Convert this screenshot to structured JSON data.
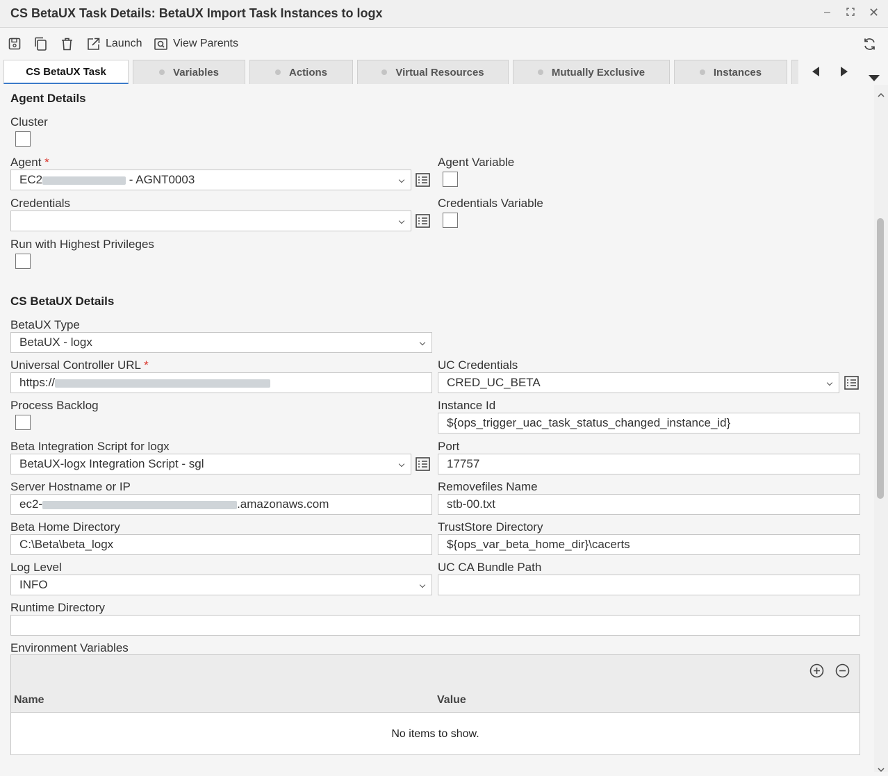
{
  "window": {
    "title": "CS BetaUX Task Details: BetaUX Import Task Instances to logx"
  },
  "toolbar": {
    "launch_label": "Launch",
    "view_parents_label": "View Parents"
  },
  "tabs": [
    {
      "label": "CS BetaUX Task"
    },
    {
      "label": "Variables"
    },
    {
      "label": "Actions"
    },
    {
      "label": "Virtual Resources"
    },
    {
      "label": "Mutually Exclusive"
    },
    {
      "label": "Instances"
    }
  ],
  "agent_details": {
    "title": "Agent Details",
    "cluster_label": "Cluster",
    "agent_label": "Agent",
    "agent_value_prefix": "EC2",
    "agent_value_suffix": " - AGNT0003",
    "agent_variable_label": "Agent Variable",
    "credentials_label": "Credentials",
    "credentials_value": "",
    "credentials_variable_label": "Credentials Variable",
    "highest_privileges_label": "Run with Highest Privileges"
  },
  "betaux_details": {
    "title": "CS BetaUX Details",
    "type_label": "BetaUX Type",
    "type_value": "BetaUX - logx",
    "uc_url_label": "Universal Controller URL",
    "uc_url_prefix": "https://",
    "uc_credentials_label": "UC Credentials",
    "uc_credentials_value": "CRED_UC_BETA",
    "process_backlog_label": "Process Backlog",
    "instance_id_label": "Instance Id",
    "instance_id_value": "${ops_trigger_uac_task_status_changed_instance_id}",
    "script_label": "Beta Integration Script for logx",
    "script_value": "BetaUX-logx Integration Script - sgl",
    "port_label": "Port",
    "port_value": "17757",
    "server_label": "Server Hostname or IP",
    "server_prefix": "ec2-",
    "server_suffix": ".amazonaws.com",
    "removefiles_label": "Removefiles Name",
    "removefiles_value": "stb-00.txt",
    "home_dir_label": "Beta Home Directory",
    "home_dir_value": "C:\\Beta\\beta_logx",
    "truststore_label": "TrustStore Directory",
    "truststore_value": "${ops_var_beta_home_dir}\\cacerts",
    "log_level_label": "Log Level",
    "log_level_value": "INFO",
    "ca_bundle_label": "UC CA Bundle Path",
    "ca_bundle_value": "",
    "runtime_dir_label": "Runtime Directory",
    "runtime_dir_value": "",
    "env_vars_label": "Environment Variables",
    "env_columns": [
      "Name",
      "Value"
    ],
    "env_empty": "No items to show."
  },
  "required_marker": "*"
}
